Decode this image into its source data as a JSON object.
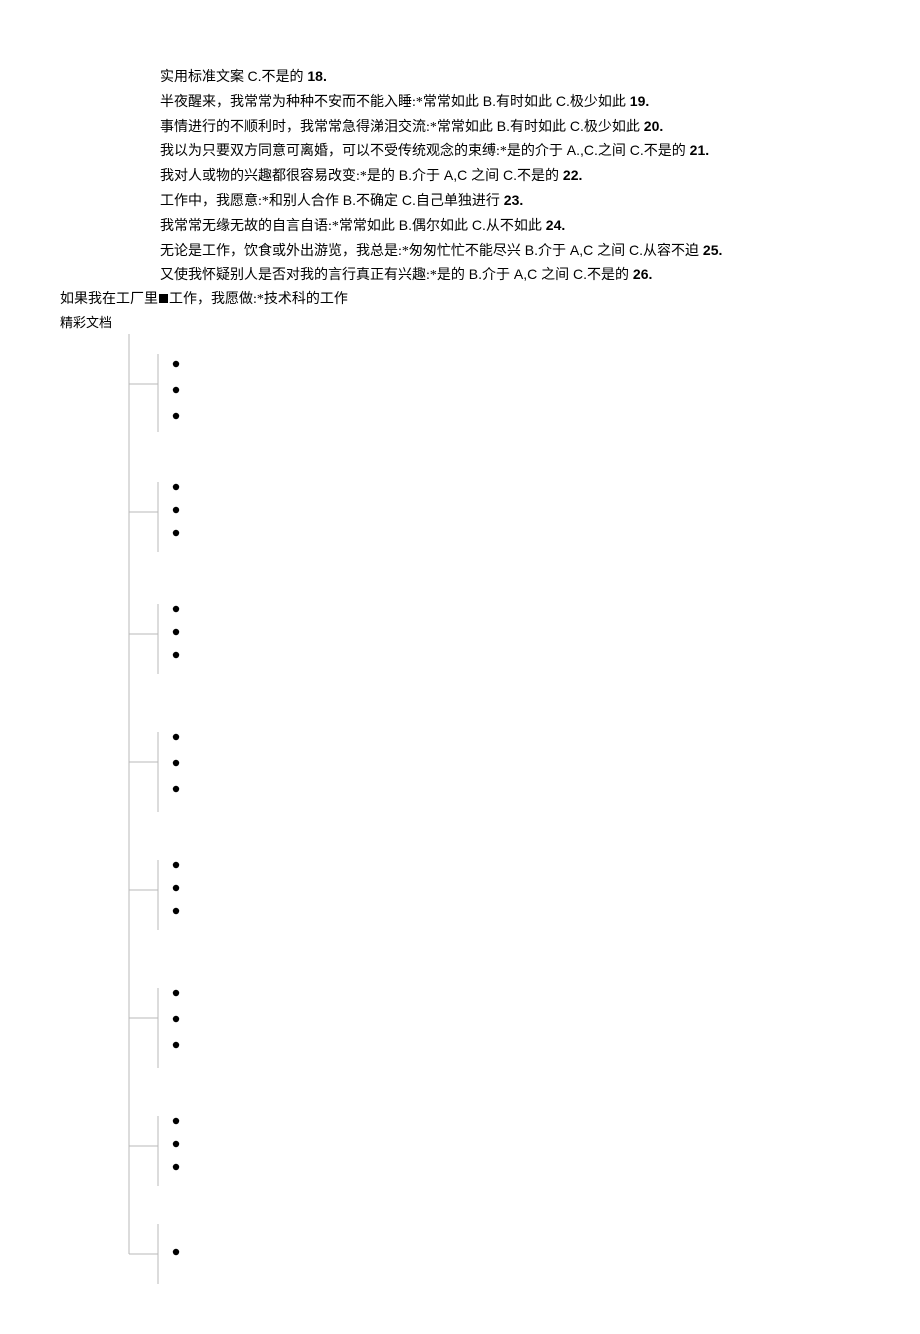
{
  "header": {
    "title": "实用标准文案",
    "title_suffix_latin": "C.",
    "title_suffix_cn": "不是的",
    "title_suffix_num": " 18."
  },
  "lines": [
    {
      "cn1": "半夜醒来，我常常为种种不安而不能入睡:*常常如此",
      "latin1": " B.",
      "cn2": "有时如此",
      "latin2": " C.",
      "cn3": "极少如此",
      "num": " 19."
    },
    {
      "cn1": "事情进行的不顺利时，我常常急得涕泪交流:*常常如此",
      "latin1": " B.",
      "cn2": "有时如此",
      "latin2": " C.",
      "cn3": "极少如此",
      "num": " 20."
    },
    {
      "cn1": "我以为只要双方同意可离婚，可以不受传统观念的束缚:*是的介于",
      "latin1": " A.,C.",
      "cn2": "之间",
      "latin2": " C.",
      "cn3": "不是的",
      "num": " 21."
    },
    {
      "cn1": "我对人或物的兴趣都很容易改变:*是的",
      "latin1": " B.",
      "cn2": "介于",
      "latin2": " A,C ",
      "cn3": "之间",
      "latin3": " C.",
      "cn4": "不是的",
      "num": " 22."
    },
    {
      "cn1": "工作中，我愿意:*和别人合作",
      "latin1": " B.",
      "cn2": "不确定",
      "latin2": " C.",
      "cn3": "自己单独进行",
      "num": " 23."
    },
    {
      "cn1": "我常常无缘无故的自言自语:*常常如此",
      "latin1": " B.",
      "cn2": "偶尔如此",
      "latin2": " C.",
      "cn3": "从不如此",
      "num": " 24."
    },
    {
      "cn1": "无论是工作，饮食或外出游览，我总是:*匆匆忙忙不能尽兴",
      "latin1": " B.",
      "cn2": "介于",
      "latin2": " A,C ",
      "cn3": "之间",
      "latin3": " C.",
      "cn4": "从容不迫",
      "num": " 25."
    },
    {
      "cn1": "又使我怀疑别人是否对我的言行真正有兴趣:*是的",
      "latin1": " B.",
      "cn2": "介于",
      "latin2": " A,C ",
      "cn3": "之间",
      "latin3": " C.",
      "cn4": "不是的",
      "num": " 26."
    }
  ],
  "unindent_line": {
    "cn": "如果我在工厂里工作，我愿做:*技术科的工作"
  },
  "footer": "精彩文档"
}
